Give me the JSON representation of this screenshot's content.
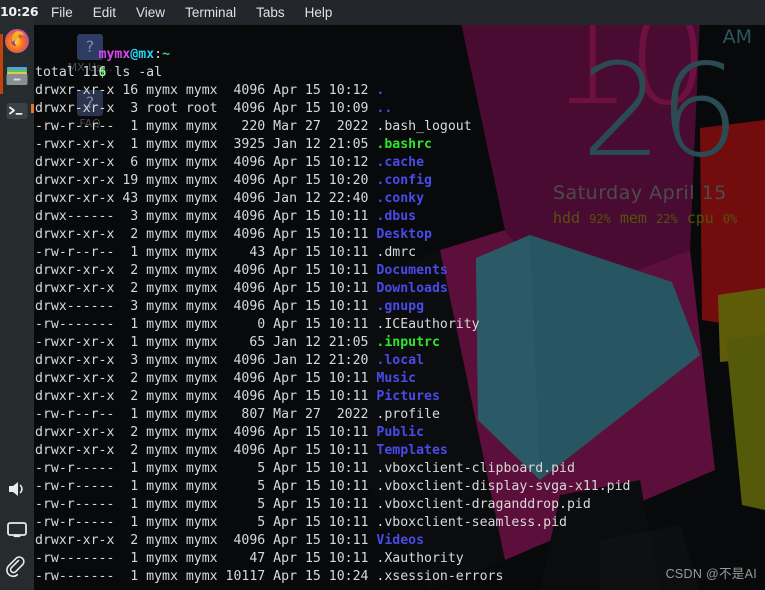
{
  "taskbar": {
    "clock": "10:26",
    "icons": [
      {
        "name": "firefox-icon",
        "label": "Firefox"
      },
      {
        "name": "file-manager-icon",
        "label": "File Manager"
      },
      {
        "name": "terminal-icon",
        "label": "Terminal"
      }
    ],
    "tray_icons": [
      {
        "name": "volume-icon",
        "label": "Volume"
      },
      {
        "name": "display-icon",
        "label": "Display"
      },
      {
        "name": "clipboard-icon",
        "label": "Clipboard"
      }
    ]
  },
  "menubar": {
    "items": [
      "File",
      "Edit",
      "View",
      "Terminal",
      "Tabs",
      "Help"
    ]
  },
  "conky": {
    "hour": "10",
    "minute": "26",
    "ampm": "AM",
    "date": "Saturday  April 15",
    "stats": [
      {
        "label": "hdd",
        "value": "92%"
      },
      {
        "label": "mem",
        "value": "22%"
      },
      {
        "label": "cpu",
        "value": "0%"
      }
    ],
    "colors": {
      "hour": "#6e1040",
      "minute": "#2b4b52",
      "ampm": "#2b585f",
      "date": "#4c4c4c",
      "stats": "#55520a"
    }
  },
  "desktop_icons": [
    {
      "label": "MX Us...",
      "glyph": "?"
    },
    {
      "label": "FAQ",
      "glyph": "?"
    }
  ],
  "terminal": {
    "prompt": {
      "user": "mymx",
      "at": "@",
      "host": "mx",
      "sep": ":",
      "path": "~"
    },
    "command_marker": "$",
    "command": " ls -al",
    "total_line": "total 116",
    "rows": [
      {
        "perm": "drwxr-xr-x",
        "links": "16",
        "owner": "mymx",
        "group": "mymx",
        "size": "4096",
        "month": "Apr",
        "day": "15",
        "time": "10:12",
        "name": ".",
        "kind": "dir"
      },
      {
        "perm": "drwxr-xr-x",
        "links": " 3",
        "owner": "root",
        "group": "root",
        "size": "4096",
        "month": "Apr",
        "day": "15",
        "time": "10:09",
        "name": "..",
        "kind": "dir"
      },
      {
        "perm": "-rw-r--r--",
        "links": " 1",
        "owner": "mymx",
        "group": "mymx",
        "size": " 220",
        "month": "Mar",
        "day": "27",
        "time": " 2022",
        "name": ".bash_logout",
        "kind": "file"
      },
      {
        "perm": "-rwxr-xr-x",
        "links": " 1",
        "owner": "mymx",
        "group": "mymx",
        "size": "3925",
        "month": "Jan",
        "day": "12",
        "time": "21:05",
        "name": ".bashrc",
        "kind": "exec"
      },
      {
        "perm": "drwxr-xr-x",
        "links": " 6",
        "owner": "mymx",
        "group": "mymx",
        "size": "4096",
        "month": "Apr",
        "day": "15",
        "time": "10:12",
        "name": ".cache",
        "kind": "dir"
      },
      {
        "perm": "drwxr-xr-x",
        "links": "19",
        "owner": "mymx",
        "group": "mymx",
        "size": "4096",
        "month": "Apr",
        "day": "15",
        "time": "10:20",
        "name": ".config",
        "kind": "dir"
      },
      {
        "perm": "drwxr-xr-x",
        "links": "43",
        "owner": "mymx",
        "group": "mymx",
        "size": "4096",
        "month": "Jan",
        "day": "12",
        "time": "22:40",
        "name": ".conky",
        "kind": "dir"
      },
      {
        "perm": "drwx------",
        "links": " 3",
        "owner": "mymx",
        "group": "mymx",
        "size": "4096",
        "month": "Apr",
        "day": "15",
        "time": "10:11",
        "name": ".dbus",
        "kind": "dir"
      },
      {
        "perm": "drwxr-xr-x",
        "links": " 2",
        "owner": "mymx",
        "group": "mymx",
        "size": "4096",
        "month": "Apr",
        "day": "15",
        "time": "10:11",
        "name": "Desktop",
        "kind": "dir"
      },
      {
        "perm": "-rw-r--r--",
        "links": " 1",
        "owner": "mymx",
        "group": "mymx",
        "size": "  43",
        "month": "Apr",
        "day": "15",
        "time": "10:11",
        "name": ".dmrc",
        "kind": "file"
      },
      {
        "perm": "drwxr-xr-x",
        "links": " 2",
        "owner": "mymx",
        "group": "mymx",
        "size": "4096",
        "month": "Apr",
        "day": "15",
        "time": "10:11",
        "name": "Documents",
        "kind": "dir"
      },
      {
        "perm": "drwxr-xr-x",
        "links": " 2",
        "owner": "mymx",
        "group": "mymx",
        "size": "4096",
        "month": "Apr",
        "day": "15",
        "time": "10:11",
        "name": "Downloads",
        "kind": "dir"
      },
      {
        "perm": "drwx------",
        "links": " 3",
        "owner": "mymx",
        "group": "mymx",
        "size": "4096",
        "month": "Apr",
        "day": "15",
        "time": "10:11",
        "name": ".gnupg",
        "kind": "dir"
      },
      {
        "perm": "-rw-------",
        "links": " 1",
        "owner": "mymx",
        "group": "mymx",
        "size": "   0",
        "month": "Apr",
        "day": "15",
        "time": "10:11",
        "name": ".ICEauthority",
        "kind": "file"
      },
      {
        "perm": "-rwxr-xr-x",
        "links": " 1",
        "owner": "mymx",
        "group": "mymx",
        "size": "  65",
        "month": "Jan",
        "day": "12",
        "time": "21:05",
        "name": ".inputrc",
        "kind": "exec"
      },
      {
        "perm": "drwxr-xr-x",
        "links": " 3",
        "owner": "mymx",
        "group": "mymx",
        "size": "4096",
        "month": "Jan",
        "day": "12",
        "time": "21:20",
        "name": ".local",
        "kind": "dir"
      },
      {
        "perm": "drwxr-xr-x",
        "links": " 2",
        "owner": "mymx",
        "group": "mymx",
        "size": "4096",
        "month": "Apr",
        "day": "15",
        "time": "10:11",
        "name": "Music",
        "kind": "dir"
      },
      {
        "perm": "drwxr-xr-x",
        "links": " 2",
        "owner": "mymx",
        "group": "mymx",
        "size": "4096",
        "month": "Apr",
        "day": "15",
        "time": "10:11",
        "name": "Pictures",
        "kind": "dir"
      },
      {
        "perm": "-rw-r--r--",
        "links": " 1",
        "owner": "mymx",
        "group": "mymx",
        "size": " 807",
        "month": "Mar",
        "day": "27",
        "time": " 2022",
        "name": ".profile",
        "kind": "file"
      },
      {
        "perm": "drwxr-xr-x",
        "links": " 2",
        "owner": "mymx",
        "group": "mymx",
        "size": "4096",
        "month": "Apr",
        "day": "15",
        "time": "10:11",
        "name": "Public",
        "kind": "dir"
      },
      {
        "perm": "drwxr-xr-x",
        "links": " 2",
        "owner": "mymx",
        "group": "mymx",
        "size": "4096",
        "month": "Apr",
        "day": "15",
        "time": "10:11",
        "name": "Templates",
        "kind": "dir"
      },
      {
        "perm": "-rw-r-----",
        "links": " 1",
        "owner": "mymx",
        "group": "mymx",
        "size": "   5",
        "month": "Apr",
        "day": "15",
        "time": "10:11",
        "name": ".vboxclient-clipboard.pid",
        "kind": "file"
      },
      {
        "perm": "-rw-r-----",
        "links": " 1",
        "owner": "mymx",
        "group": "mymx",
        "size": "   5",
        "month": "Apr",
        "day": "15",
        "time": "10:11",
        "name": ".vboxclient-display-svga-x11.pid",
        "kind": "file"
      },
      {
        "perm": "-rw-r-----",
        "links": " 1",
        "owner": "mymx",
        "group": "mymx",
        "size": "   5",
        "month": "Apr",
        "day": "15",
        "time": "10:11",
        "name": ".vboxclient-draganddrop.pid",
        "kind": "file"
      },
      {
        "perm": "-rw-r-----",
        "links": " 1",
        "owner": "mymx",
        "group": "mymx",
        "size": "   5",
        "month": "Apr",
        "day": "15",
        "time": "10:11",
        "name": ".vboxclient-seamless.pid",
        "kind": "file"
      },
      {
        "perm": "drwxr-xr-x",
        "links": " 2",
        "owner": "mymx",
        "group": "mymx",
        "size": "4096",
        "month": "Apr",
        "day": "15",
        "time": "10:11",
        "name": "Videos",
        "kind": "dir"
      },
      {
        "perm": "-rw-------",
        "links": " 1",
        "owner": "mymx",
        "group": "mymx",
        "size": "  47",
        "month": "Apr",
        "day": "15",
        "time": "10:11",
        "name": ".Xauthority",
        "kind": "file"
      },
      {
        "perm": "-rw-------",
        "links": " 1",
        "owner": "mymx",
        "group": "mymx",
        "size": "10117",
        "month": "Apr",
        "day": "15",
        "time": "10:24",
        "name": ".xsession-errors",
        "kind": "file"
      }
    ]
  },
  "watermark": "CSDN @不是AI"
}
